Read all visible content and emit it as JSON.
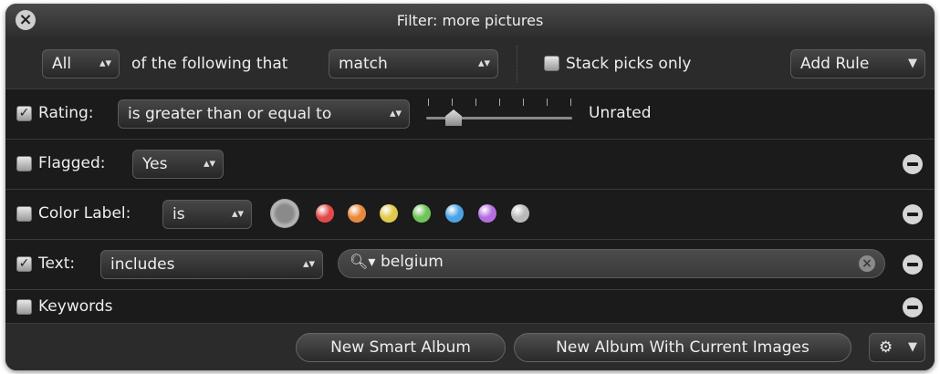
{
  "title": "Filter: more pictures",
  "header": {
    "match_scope": "All",
    "of_following_text": "of the following that",
    "match_mode": "match",
    "stack_picks_label": "Stack picks only",
    "add_rule_label": "Add Rule"
  },
  "rules": {
    "rating": {
      "label": "Rating:",
      "checked": true,
      "operator": "is greater than or equal to",
      "value_label": "Unrated"
    },
    "flagged": {
      "label": "Flagged:",
      "checked": false,
      "value": "Yes"
    },
    "color_label": {
      "label": "Color Label:",
      "checked": false,
      "operator": "is",
      "colors": [
        "#e24a4a",
        "#e8883a",
        "#e0c94a",
        "#6ec458",
        "#4aa3e6",
        "#b36ee0",
        "#b9b9b9"
      ]
    },
    "text": {
      "label": "Text:",
      "checked": true,
      "operator": "includes",
      "search_value": "belgium"
    },
    "keywords": {
      "label": "Keywords",
      "checked": false
    }
  },
  "footer": {
    "new_smart_album": "New Smart Album",
    "new_album_current": "New Album With Current Images"
  }
}
